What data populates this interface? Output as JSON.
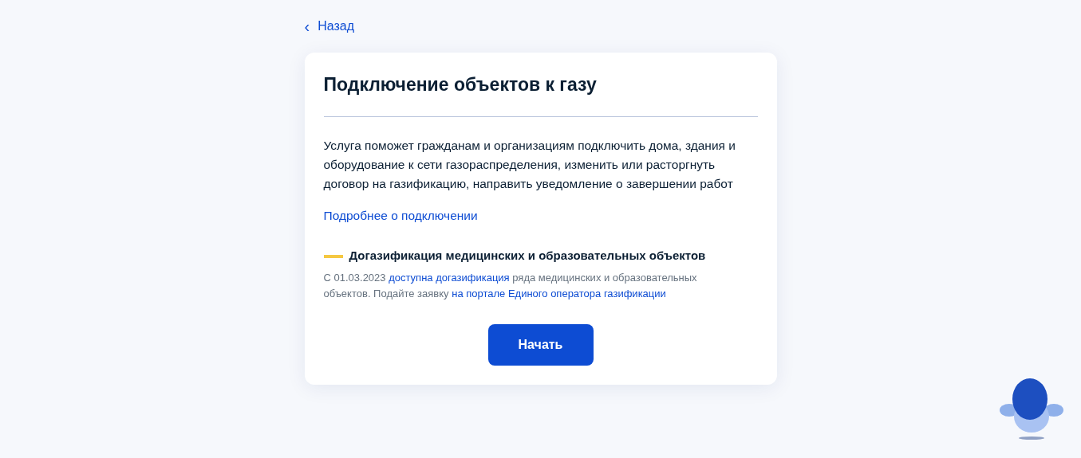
{
  "back_link": {
    "icon": "‹",
    "label": "Назад"
  },
  "card": {
    "title": "Подключение объектов к газу",
    "description": "Услуга поможет гражданам и организациям подключить дома, здания и оборудование к сети газораспределения, изменить или расторгнуть договор на газификацию, направить уведомление о завершении работ",
    "more_link": "Подробнее о подключении",
    "notice": {
      "title": "Догазификация медицинских и образовательных объектов",
      "color": "#f5c842",
      "segments": [
        {
          "kind": "text",
          "text": "С 01.03.2023 "
        },
        {
          "kind": "link",
          "text": "доступна догазификация"
        },
        {
          "kind": "text",
          "text": " ряда медицинских и образовательных объектов. Подайте заявку "
        },
        {
          "kind": "link",
          "text": "на портале Единого оператора газификации"
        }
      ]
    },
    "button": "Начать"
  }
}
